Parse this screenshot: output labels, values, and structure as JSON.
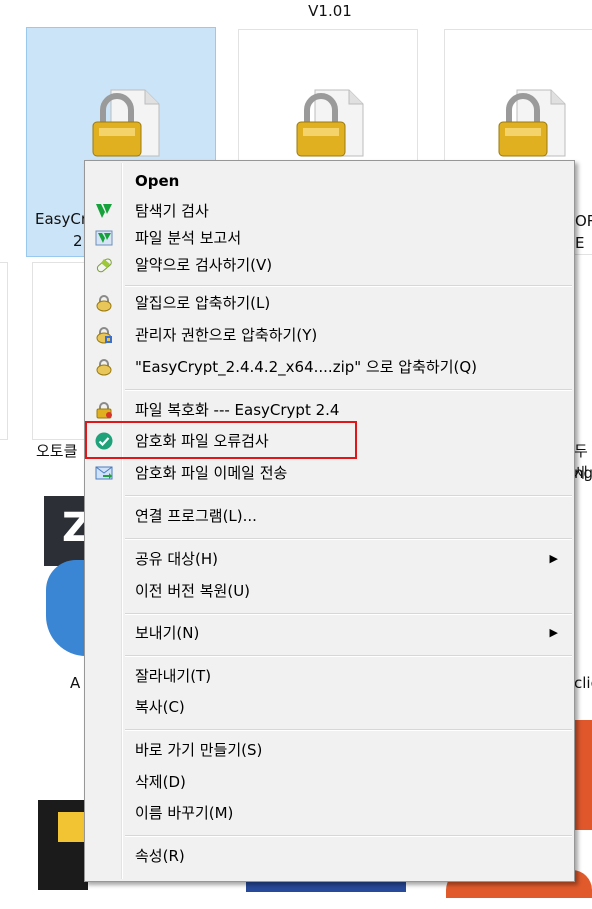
{
  "header": {
    "version": "V1.01"
  },
  "files": {
    "tile1_label_line1": "EasyCr",
    "tile1_label_line2": "2",
    "tile3_label_line1": "OR",
    "tile3_label_line2": "E",
    "row2_left_label": "오토클",
    "row2_right_label1": "두세",
    "row2_right_label2": "ng",
    "row3_left_label": "A",
    "row3_right_label": "clic"
  },
  "menu": {
    "open": "Open",
    "scan_explorer": "탐색기 검사",
    "file_analysis": "파일 분석 보고서",
    "alyac_scan": "알약으로 검사하기(V)",
    "alzip_compress": "알집으로 압축하기(L)",
    "admin_compress": "관리자 권한으로 압축하기(Y)",
    "zip_compress": "\"EasyCrypt_2.4.4.2_x64....zip\" 으로 압축하기(Q)",
    "decrypt": "파일 복호화 --- EasyCrypt 2.4",
    "error_check": "암호화 파일 오류검사",
    "email_send": "암호화 파일 이메일 전송",
    "open_with": "연결 프로그램(L)...",
    "share_with": "공유 대상(H)",
    "restore_prev": "이전 버전 복원(U)",
    "send_to": "보내기(N)",
    "cut": "잘라내기(T)",
    "copy": "복사(C)",
    "create_shortcut": "바로 가기 만들기(S)",
    "delete": "삭제(D)",
    "rename": "이름 바꾸기(M)",
    "properties": "속성(R)"
  }
}
